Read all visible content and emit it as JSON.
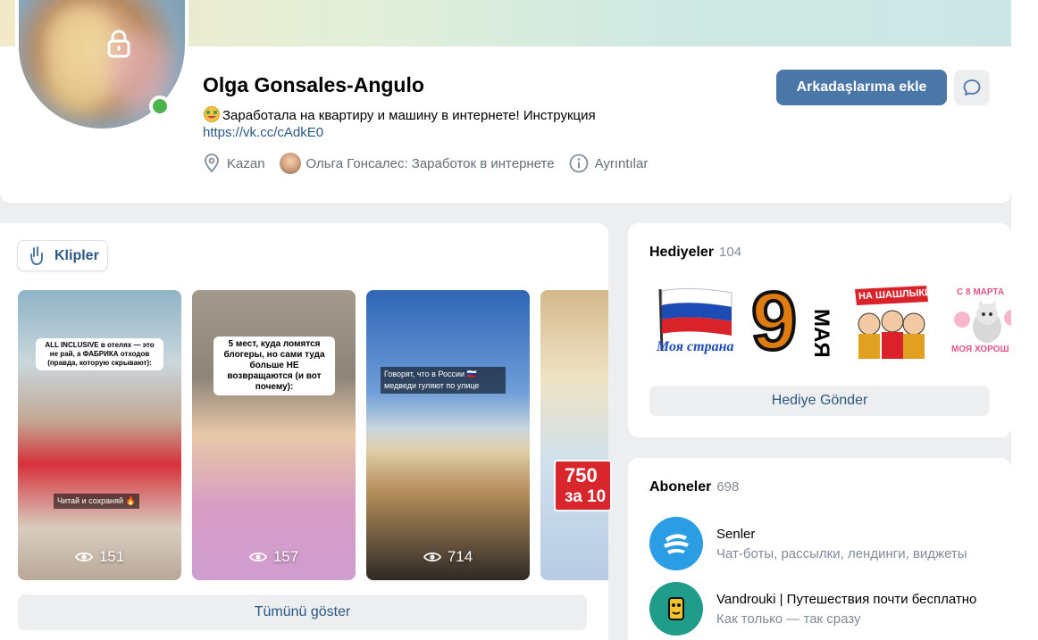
{
  "profile": {
    "name": "Olga Gonsales-Angulo",
    "status": "Заработала на квартиру и машину в интернете! Инструкция",
    "link": "https://vk.cc/cAdkE0",
    "city": "Kazan",
    "community": "Ольга Гонсалес: Заработок в интернете",
    "details": "Ayrıntılar",
    "add_friend_label": "Arkadaşlarıma ekle"
  },
  "clips": {
    "tab_label": "Klipler",
    "items": [
      {
        "caption": "ALL INCLUSIVE в отелях — это не рай, а ФАБРИКА отходов (правда, которую скрывают):",
        "subtitle": "Читай и сохраняй 🔥",
        "views": "151"
      },
      {
        "caption": "5 мест, куда ломятся блогеры, но сами туда больше НЕ возвращаются (и вот почему):",
        "views": "157"
      },
      {
        "caption": "Говорят, что в России 🇷🇺 медведи гуляют по улице",
        "views": "714"
      },
      {
        "price_line1": "750",
        "price_line2": "за 10"
      }
    ],
    "show_all_label": "Tümünü göster"
  },
  "gifts": {
    "title": "Hediyeler",
    "count": "104",
    "items": [
      {
        "icon": "russia-flag-gift",
        "text": "Моя страна"
      },
      {
        "icon": "may-9-ribbon-gift",
        "big": "9",
        "text": "МАЯ"
      },
      {
        "icon": "shashlik-gift",
        "text": "НА ШАШЛЫКИ!"
      },
      {
        "icon": "kitten-march-8-gift",
        "text": "С 8 МАРТА",
        "text2": "МОЯ ХОРОШ"
      }
    ],
    "send_label": "Hediye Gönder"
  },
  "subscribers": {
    "title": "Aboneler",
    "count": "698",
    "items": [
      {
        "name": "Senler",
        "desc": "Чат-боты, рассылки, лендинги, виджеты",
        "color": "#2b9de5"
      },
      {
        "name": "Vandrouki | Путешествия почти бесплатно",
        "desc": "Как только — так сразу",
        "color": "#1f9d8a"
      }
    ]
  },
  "colors": {
    "accent": "#4a76a8",
    "link": "#2a5885",
    "online": "#4bb34b"
  }
}
